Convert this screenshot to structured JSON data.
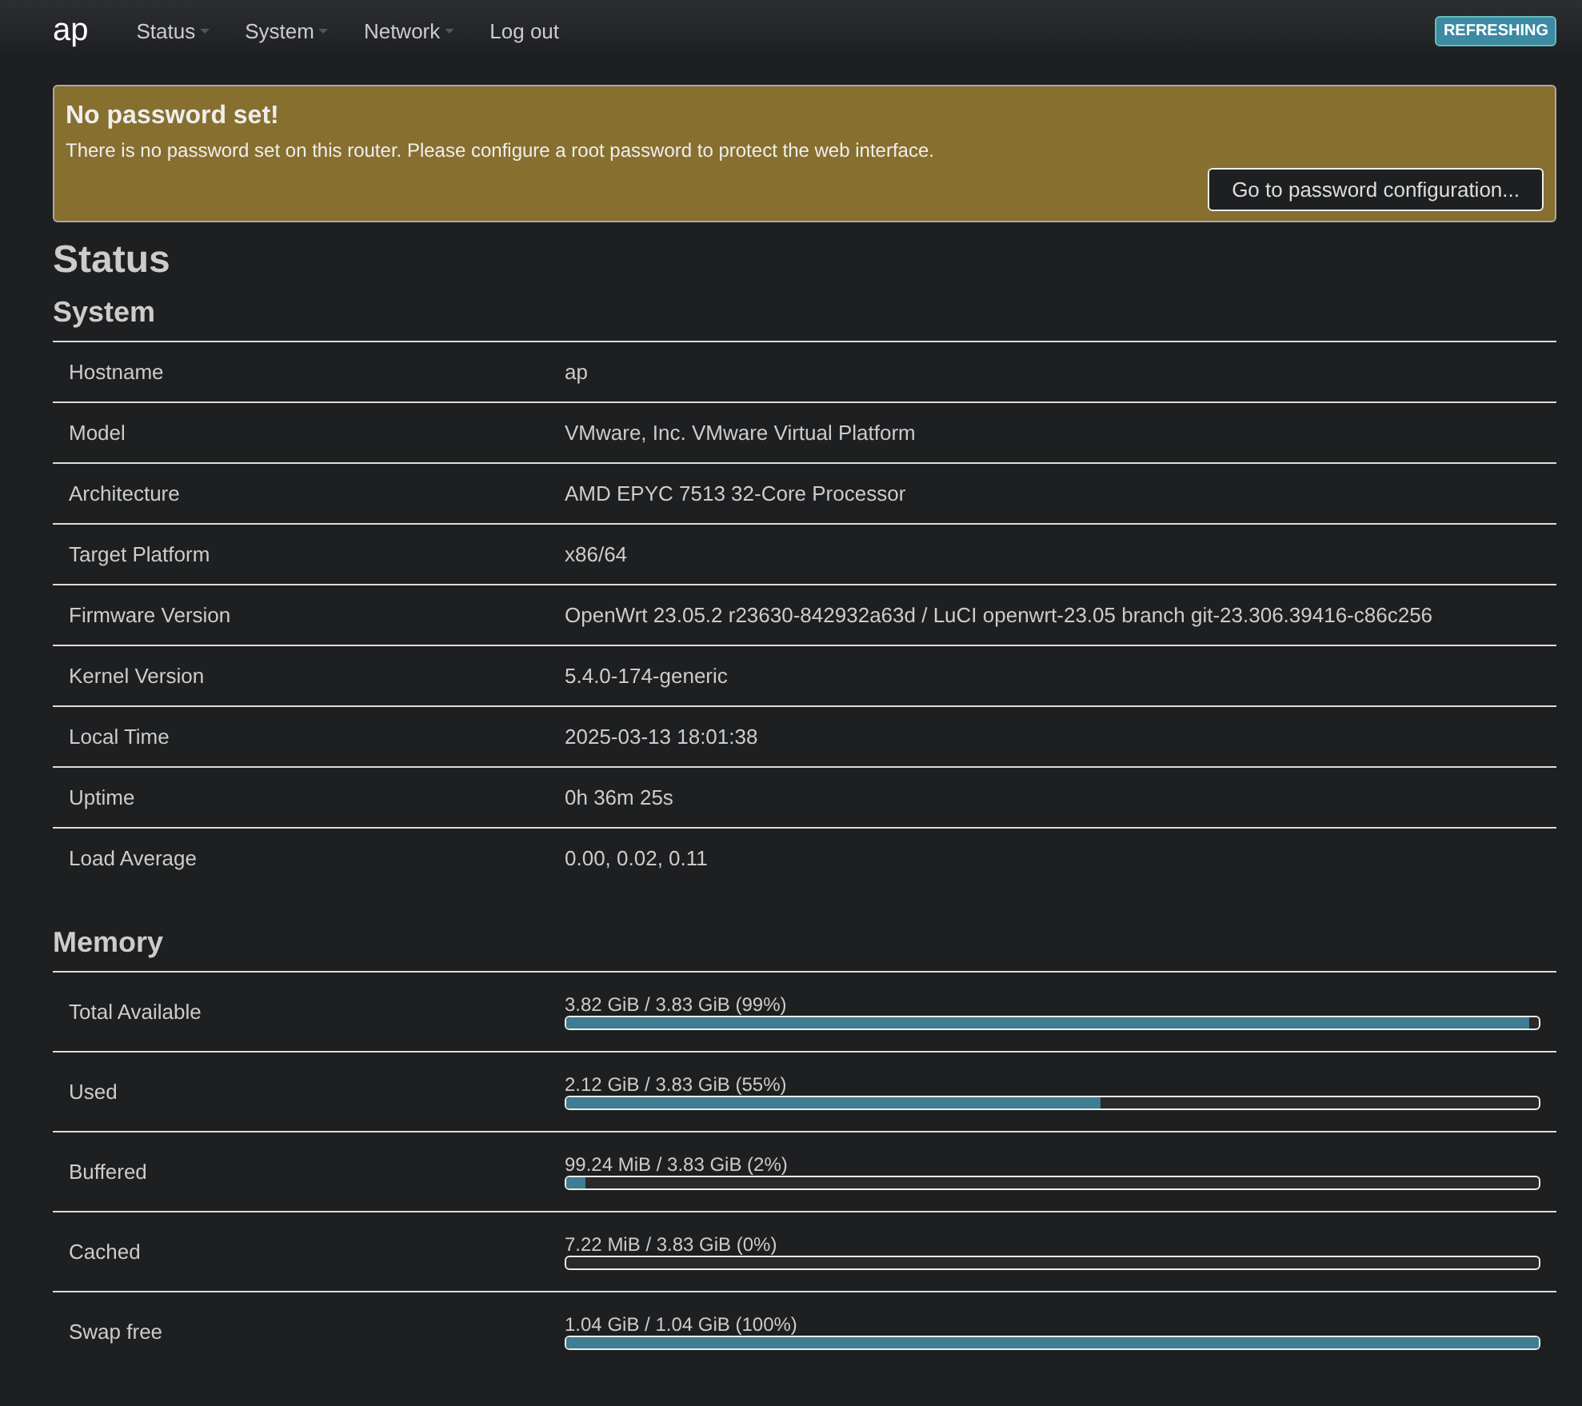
{
  "header": {
    "brand": "ap",
    "menu": [
      {
        "label": "Status",
        "dropdown": true
      },
      {
        "label": "System",
        "dropdown": true
      },
      {
        "label": "Network",
        "dropdown": true
      },
      {
        "label": "Log out",
        "dropdown": false
      }
    ],
    "indicator": "REFRESHING"
  },
  "alert": {
    "title": "No password set!",
    "message": "There is no password set on this router. Please configure a root password to protect the web interface.",
    "button": "Go to password configuration..."
  },
  "page_title": "Status",
  "system": {
    "title": "System",
    "rows": [
      {
        "label": "Hostname",
        "value": "ap"
      },
      {
        "label": "Model",
        "value": "VMware, Inc. VMware Virtual Platform"
      },
      {
        "label": "Architecture",
        "value": "AMD EPYC 7513 32-Core Processor"
      },
      {
        "label": "Target Platform",
        "value": "x86/64"
      },
      {
        "label": "Firmware Version",
        "value": "OpenWrt 23.05.2 r23630-842932a63d / LuCI openwrt-23.05 branch git-23.306.39416-c86c256"
      },
      {
        "label": "Kernel Version",
        "value": "5.4.0-174-generic"
      },
      {
        "label": "Local Time",
        "value": "2025-03-13 18:01:38"
      },
      {
        "label": "Uptime",
        "value": "0h 36m 25s"
      },
      {
        "label": "Load Average",
        "value": "0.00, 0.02, 0.11"
      }
    ]
  },
  "memory": {
    "title": "Memory",
    "rows": [
      {
        "label": "Total Available",
        "reading": "3.82 GiB / 3.83 GiB (99%)",
        "level": 0.99
      },
      {
        "label": "Used",
        "reading": "2.12 GiB / 3.83 GiB (55%)",
        "level": 0.55
      },
      {
        "label": "Buffered",
        "reading": "99.24 MiB / 3.83 GiB (2%)",
        "level": 0.02
      },
      {
        "label": "Cached",
        "reading": "7.22 MiB / 3.83 GiB (0%)",
        "level": 0
      },
      {
        "label": "Swap free",
        "reading": "1.04 GiB / 1.04 GiB (100%)",
        "level": 1
      }
    ]
  }
}
